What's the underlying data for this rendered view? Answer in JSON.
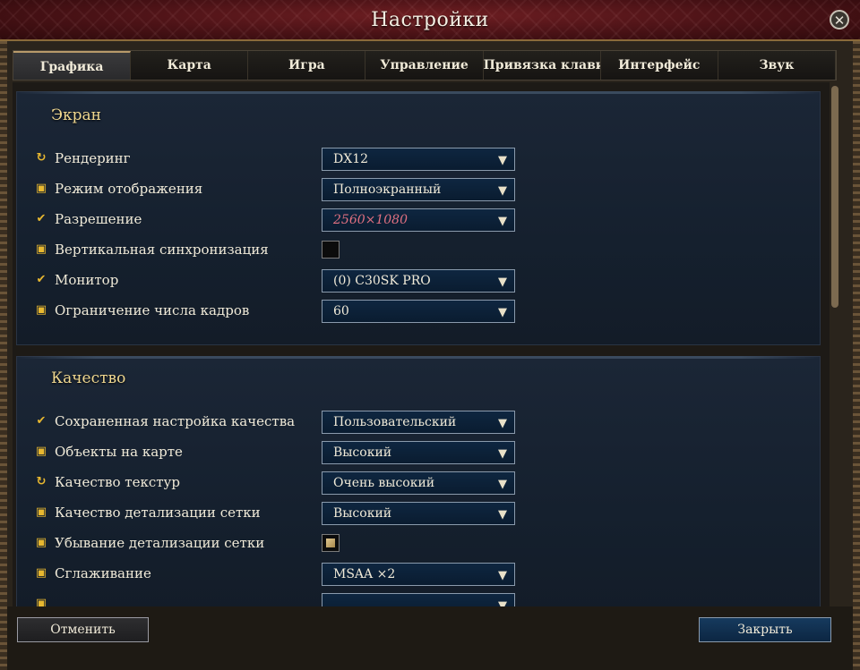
{
  "window": {
    "title": "Настройки",
    "close_glyph": "✕"
  },
  "tabs": [
    {
      "label": "Графика",
      "active": true
    },
    {
      "label": "Карта",
      "active": false
    },
    {
      "label": "Игра",
      "active": false
    },
    {
      "label": "Управление",
      "active": false
    },
    {
      "label": "Привязка клавиш ввода",
      "active": false
    },
    {
      "label": "Интерфейс",
      "active": false
    },
    {
      "label": "Звук",
      "active": false
    }
  ],
  "sections": {
    "screen": {
      "title": "Экран",
      "rows": [
        {
          "icon": "refresh-icon",
          "label": "Рендеринг",
          "control": "dropdown",
          "value": "DX12"
        },
        {
          "icon": "save-icon",
          "label": "Режим отображения",
          "control": "dropdown",
          "value": "Полноэкранный"
        },
        {
          "icon": "apply-check-icon",
          "label": "Разрешение",
          "control": "dropdown",
          "value": "2560×1080",
          "highlight": true
        },
        {
          "icon": "save-icon",
          "label": "Вертикальная синхронизация",
          "control": "checkbox",
          "checked": false
        },
        {
          "icon": "apply-check-icon",
          "label": "Монитор",
          "control": "dropdown",
          "value": "(0) C30SK PRO"
        },
        {
          "icon": "save-icon",
          "label": "Ограничение числа кадров",
          "control": "dropdown",
          "value": "60"
        }
      ]
    },
    "quality": {
      "title": "Качество",
      "rows": [
        {
          "icon": "apply-check-icon",
          "label": "Сохраненная настройка качества",
          "control": "dropdown",
          "value": "Пользовательский"
        },
        {
          "icon": "save-icon",
          "label": "Объекты на карте",
          "control": "dropdown",
          "value": "Высокий"
        },
        {
          "icon": "refresh-icon",
          "label": "Качество текстур",
          "control": "dropdown",
          "value": "Очень высокий"
        },
        {
          "icon": "save-icon",
          "label": "Качество детализации сетки",
          "control": "dropdown",
          "value": "Высокий"
        },
        {
          "icon": "save-icon",
          "label": "Убывание детализации сетки",
          "control": "checkbox",
          "checked": true
        },
        {
          "icon": "save-icon",
          "label": "Сглаживание",
          "control": "dropdown",
          "value": "MSAA ×2"
        }
      ]
    }
  },
  "footer": {
    "cancel_label": "Отменить",
    "close_label": "Закрыть"
  },
  "colors": {
    "accent_gold": "#e8b830",
    "section_title": "#f0d890",
    "highlight_value": "#e07080",
    "titlebar": "#4a1216"
  }
}
